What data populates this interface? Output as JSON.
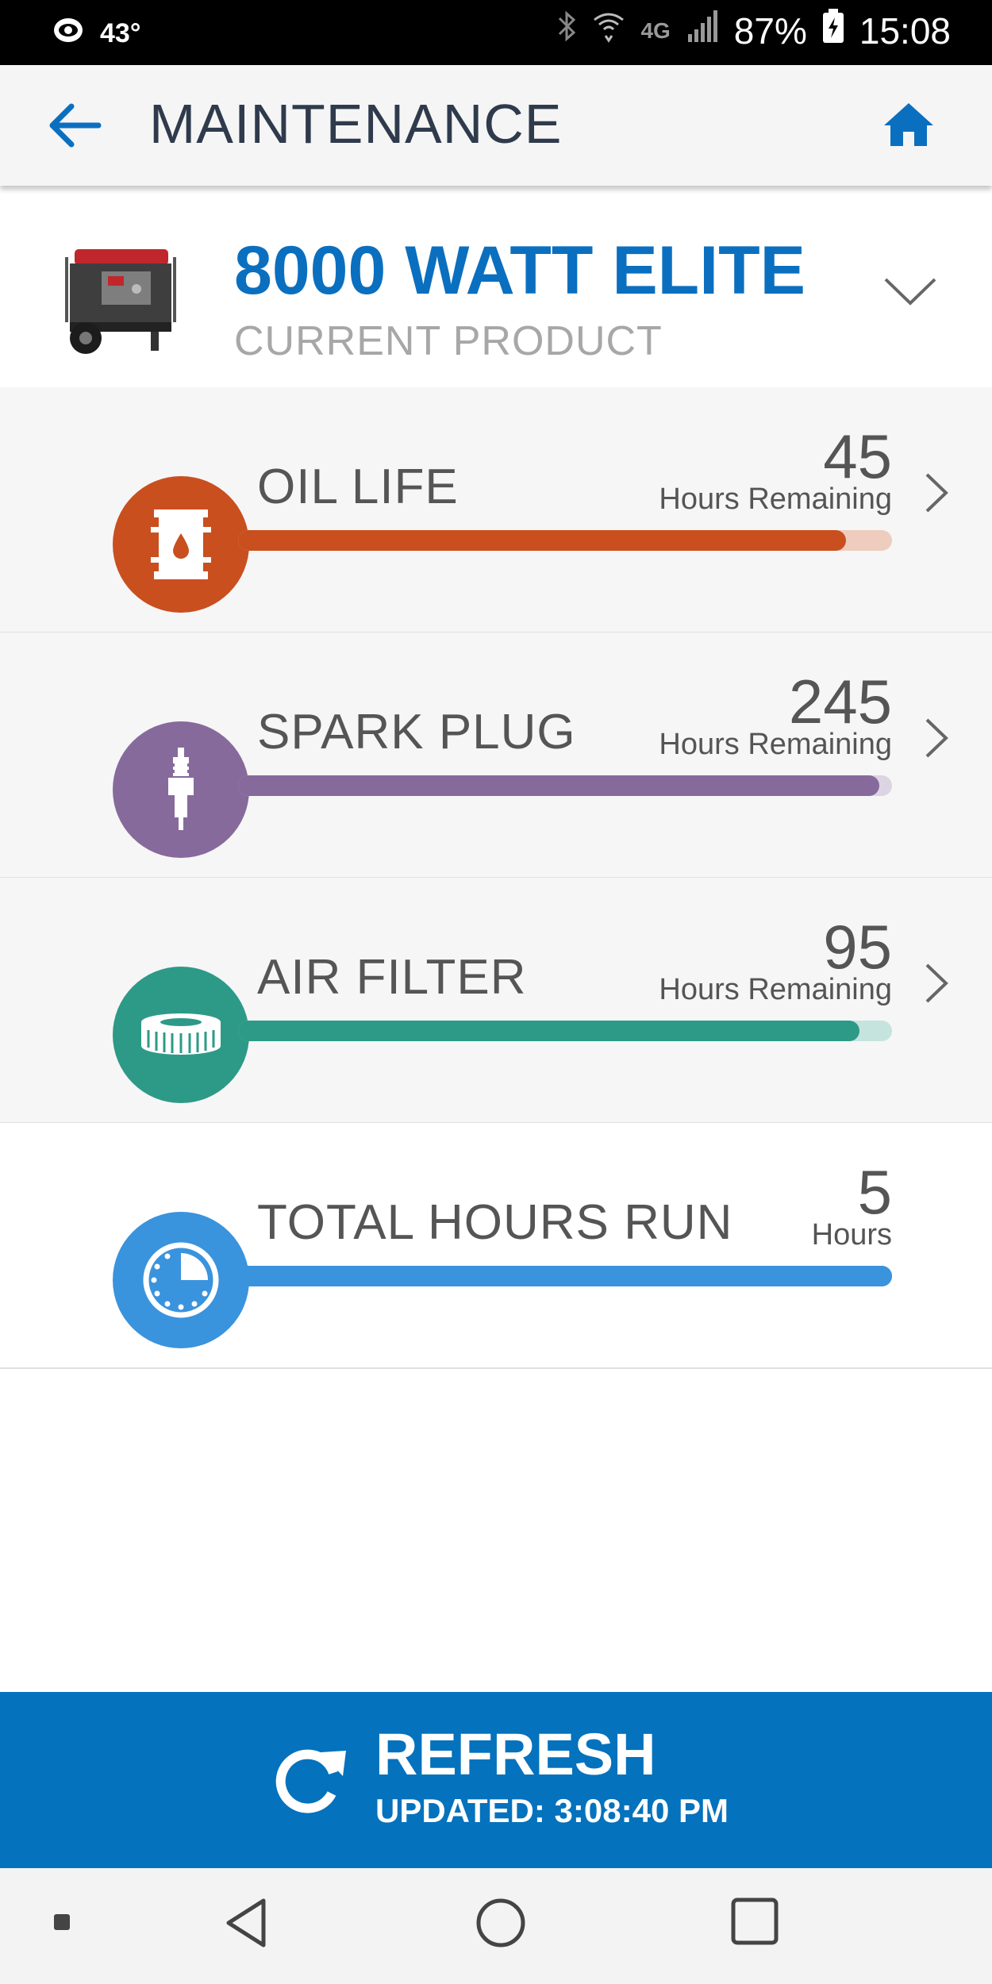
{
  "status_bar": {
    "temperature": "43°",
    "network": "4G",
    "battery": "87%",
    "time": "15:08"
  },
  "header": {
    "title": "MAINTENANCE",
    "back_icon": "arrow-left-icon",
    "home_icon": "home-icon",
    "accent_color": "#0b6fbf"
  },
  "product": {
    "name": "8000 WATT ELITE",
    "subtitle": "CURRENT PRODUCT",
    "image": "generator-image"
  },
  "metrics": [
    {
      "label": "OIL LIFE",
      "value": "45",
      "unit": "Hours Remaining",
      "icon": "oil-drum-icon",
      "color": "#c94f1f",
      "track_color": "#eecdbf",
      "fill_fraction": 0.93,
      "has_chevron": true
    },
    {
      "label": "SPARK PLUG",
      "value": "245",
      "unit": "Hours Remaining",
      "icon": "spark-plug-icon",
      "color": "#876a9c",
      "track_color": "#ddd4e3",
      "fill_fraction": 0.98,
      "has_chevron": true
    },
    {
      "label": "AIR FILTER",
      "value": "95",
      "unit": "Hours Remaining",
      "icon": "air-filter-icon",
      "color": "#2d9a87",
      "track_color": "#c5e4de",
      "fill_fraction": 0.95,
      "has_chevron": true
    },
    {
      "label": "TOTAL HOURS RUN",
      "value": "5",
      "unit": "Hours",
      "icon": "clock-icon",
      "color": "#3a93dd",
      "track_color": "#3a93dd",
      "fill_fraction": 1.0,
      "has_chevron": false
    }
  ],
  "refresh": {
    "label": "REFRESH",
    "updated": "UPDATED: 3:08:40 PM",
    "icon": "refresh-icon",
    "color": "#0472bd"
  },
  "nav_bar": {
    "buttons": [
      "menu-dot-icon",
      "back-triangle-icon",
      "home-circle-icon",
      "recents-square-icon"
    ]
  }
}
